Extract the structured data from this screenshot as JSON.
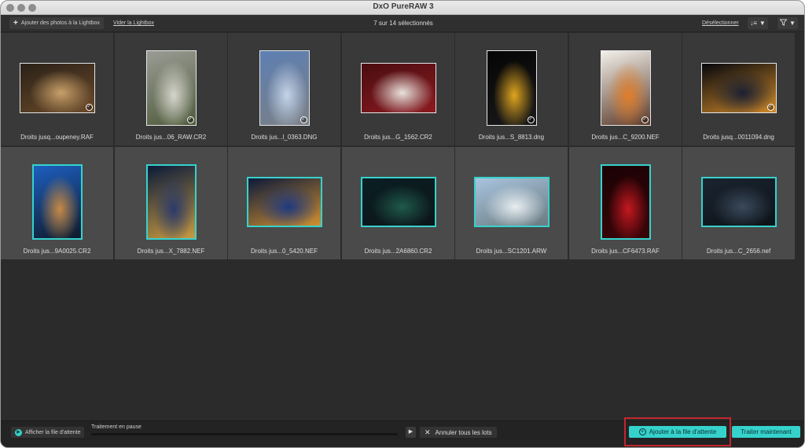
{
  "window": {
    "title": "DxO PureRAW 3",
    "controls": [
      {
        "name": "close",
        "color": "#8d8d8d"
      },
      {
        "name": "minimize",
        "color": "#8d8d8d"
      },
      {
        "name": "zoom",
        "color": "#8d8d8d"
      }
    ]
  },
  "toolbar": {
    "add_label": "Ajouter des photos à la Lightbox",
    "add_icon": "plus-icon",
    "clear_label": "Vider la Lightbox",
    "selection_count": "7 sur 14 sélectionnés",
    "deselect_label": "Désélectionner",
    "sort_icon": "sort-icon",
    "filter_icon": "filter-icon"
  },
  "accent": "#35d2cc",
  "photos": [
    {
      "filename": "Droits jusq...oupeney.RAF",
      "selected": false,
      "checked": true,
      "orientation": "landscape",
      "colors": [
        "#2a2118",
        "#c8a06a",
        "#6b4a2a"
      ]
    },
    {
      "filename": "Droits jus...06_RAW.CR2",
      "selected": false,
      "checked": true,
      "orientation": "portrait",
      "colors": [
        "#9a9c94",
        "#d6d6cc",
        "#4f5b3c"
      ]
    },
    {
      "filename": "Droits jus...l_0363.DNG",
      "selected": false,
      "checked": true,
      "orientation": "portrait",
      "colors": [
        "#5d7fb3",
        "#c4d3e8",
        "#7a7f85"
      ]
    },
    {
      "filename": "Droits jus...G_1562.CR2",
      "selected": false,
      "checked": false,
      "orientation": "landscape",
      "colors": [
        "#4a0d10",
        "#e8e2dc",
        "#8b1a20"
      ]
    },
    {
      "filename": "Droits jus...S_8813.dng",
      "selected": false,
      "checked": true,
      "orientation": "portrait",
      "colors": [
        "#050505",
        "#e0a520",
        "#1a1a1a"
      ]
    },
    {
      "filename": "Droits jus...C_9200.NEF",
      "selected": false,
      "checked": true,
      "orientation": "portrait",
      "colors": [
        "#f2f0ea",
        "#e07d2a",
        "#5a3a2a"
      ]
    },
    {
      "filename": "Droits jusq...0011094.dng",
      "selected": false,
      "checked": true,
      "orientation": "landscape",
      "colors": [
        "#05070d",
        "#1a2033",
        "#d08a2a"
      ]
    },
    {
      "filename": "Droits jus...9A0025.CR2",
      "selected": true,
      "checked": false,
      "orientation": "portrait",
      "colors": [
        "#1d5fc0",
        "#c78a45",
        "#0f1a2a"
      ]
    },
    {
      "filename": "Droits jus...X_7882.NEF",
      "selected": true,
      "checked": false,
      "orientation": "portrait",
      "colors": [
        "#0a1a3a",
        "#2a3a6a",
        "#c89a40"
      ]
    },
    {
      "filename": "Droits jus...0_5420.NEF",
      "selected": true,
      "checked": false,
      "orientation": "landscape",
      "colors": [
        "#0d1a3a",
        "#1f3a80",
        "#d09030"
      ]
    },
    {
      "filename": "Droits jus...2A6860.CR2",
      "selected": true,
      "checked": false,
      "orientation": "landscape",
      "colors": [
        "#0a1f24",
        "#1f5a4a",
        "#0d1418"
      ]
    },
    {
      "filename": "Droits jus...SC1201.ARW",
      "selected": true,
      "checked": false,
      "orientation": "landscape",
      "colors": [
        "#a8c4de",
        "#e8eef0",
        "#6a7a80"
      ]
    },
    {
      "filename": "Droits jus...CF6473.RAF",
      "selected": true,
      "checked": false,
      "orientation": "portrait",
      "colors": [
        "#1a0204",
        "#c41820",
        "#3a0508"
      ]
    },
    {
      "filename": "Droits jus...C_2656.nef",
      "selected": true,
      "checked": false,
      "orientation": "landscape",
      "colors": [
        "#1a2430",
        "#3a4a5a",
        "#0d1218"
      ]
    }
  ],
  "statusbar": {
    "show_queue_label": "Afficher la file d'attente",
    "status_text": "Traitement en pause",
    "progress": 0,
    "cancel_label": "Annuler tous les lots",
    "add_to_queue_label": "Ajouter à la file d'attente",
    "process_now_label": "Traiter maintenant"
  }
}
